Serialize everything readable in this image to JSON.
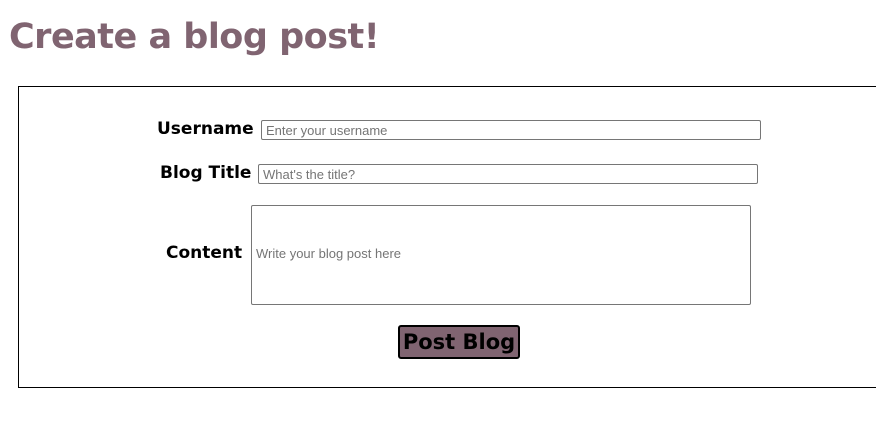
{
  "page": {
    "title": "Create a blog post!"
  },
  "form": {
    "username": {
      "label": "Username",
      "placeholder": "Enter your username",
      "value": ""
    },
    "blog_title": {
      "label": "Blog Title",
      "placeholder": "What's the title?",
      "value": ""
    },
    "content": {
      "label": "Content",
      "placeholder": "Write your blog post here",
      "value": ""
    },
    "submit_label": "Post Blog"
  },
  "colors": {
    "accent": "#806471",
    "border": "#000000",
    "input_border": "#767676",
    "placeholder": "#757575"
  }
}
